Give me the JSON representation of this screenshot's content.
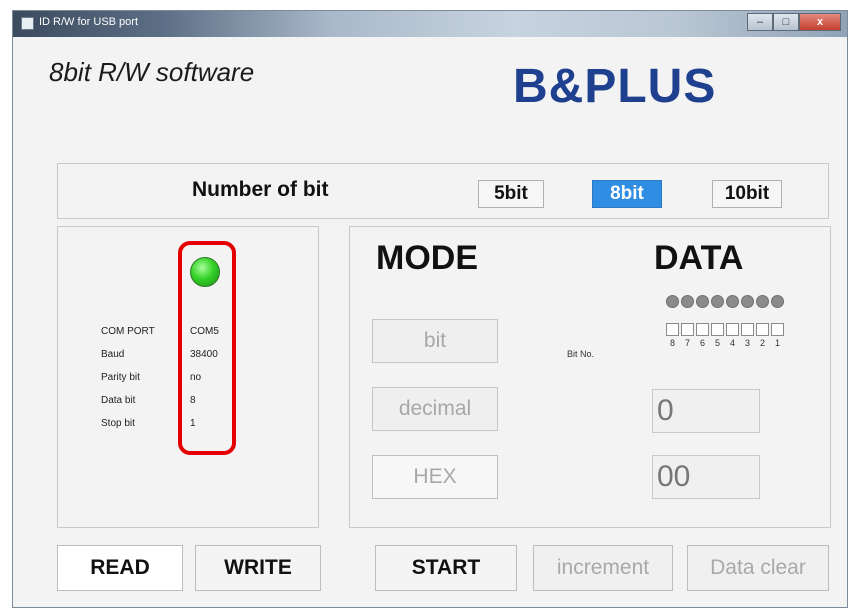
{
  "window": {
    "title": "ID R/W for USB port",
    "controls": {
      "minimize": "–",
      "maximize": "□",
      "close": "x"
    }
  },
  "header": {
    "app_title": "8bit R/W software",
    "logo_text": "B&PLUS"
  },
  "bit_select": {
    "label": "Number of bit",
    "options": [
      "5bit",
      "8bit",
      "10bit"
    ],
    "selected": "8bit"
  },
  "com": {
    "status_led_color": "#36d12a",
    "fields": [
      {
        "label": "COM PORT",
        "value": "COM5"
      },
      {
        "label": "Baud",
        "value": "38400"
      },
      {
        "label": "Parity bit",
        "value": "no"
      },
      {
        "label": "Data bit",
        "value": "8"
      },
      {
        "label": "Stop bit",
        "value": "1"
      }
    ]
  },
  "mode": {
    "heading": "MODE",
    "buttons": {
      "bit": "bit",
      "decimal": "decimal",
      "hex": "HEX"
    }
  },
  "data": {
    "heading": "DATA",
    "bit_no_label": "Bit No.",
    "bit_numbers": [
      "8",
      "7",
      "6",
      "5",
      "4",
      "3",
      "2",
      "1"
    ],
    "decimal_value": "0",
    "hex_value": "00"
  },
  "actions": {
    "read": "READ",
    "write": "WRITE",
    "start": "START",
    "increment": "increment",
    "data_clear": "Data clear"
  },
  "colors": {
    "accent_selected": "#2f8de4",
    "highlight_box": "#e50000",
    "logo": "#1f3f8f"
  }
}
